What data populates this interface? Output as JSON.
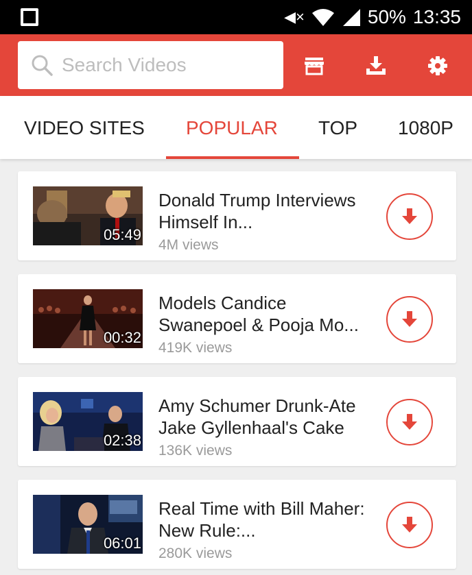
{
  "status_bar": {
    "battery": "50%",
    "time": "13:35"
  },
  "search": {
    "placeholder": "Search Videos"
  },
  "header_icons": [
    "store-icon",
    "download-icon",
    "settings-icon"
  ],
  "tabs": [
    {
      "label": "VIDEO SITES",
      "active": false
    },
    {
      "label": "POPULAR",
      "active": true
    },
    {
      "label": "TOP",
      "active": false
    },
    {
      "label": "1080P",
      "active": false
    }
  ],
  "videos": [
    {
      "title": "Donald Trump Interviews Himself In...",
      "views": "4M views",
      "duration": "05:49"
    },
    {
      "title": "Models Candice Swanepoel & Pooja Mo...",
      "views": "419K views",
      "duration": "00:32"
    },
    {
      "title": "Amy Schumer Drunk-Ate Jake Gyllenhaal's Cake",
      "views": "136K views",
      "duration": "02:38"
    },
    {
      "title": "Real Time with Bill Maher: New Rule:...",
      "views": "280K views",
      "duration": "06:01"
    }
  ],
  "colors": {
    "accent": "#e4463a",
    "background": "#efefef",
    "card": "#ffffff",
    "views_text": "#9a9a9a"
  }
}
